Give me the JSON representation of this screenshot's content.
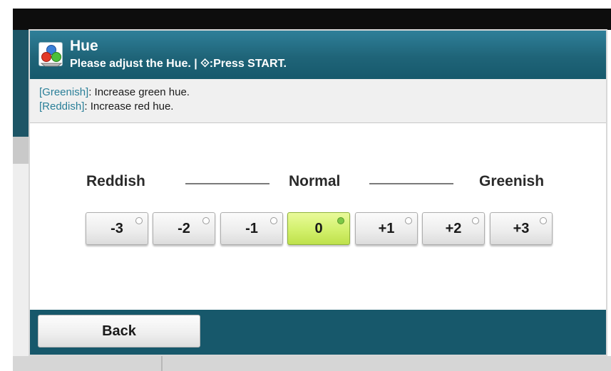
{
  "dialog": {
    "title": "Hue",
    "subtitle": "Please adjust the Hue. | ⟐:Press START.",
    "icon": "color-circles-icon"
  },
  "info": {
    "line1_key": "[Greenish]",
    "line1_text": ": Increase green hue.",
    "line2_key": "[Reddish]",
    "line2_text": ": Increase red hue."
  },
  "scale": {
    "left_label": "Reddish",
    "center_label": "Normal",
    "right_label": "Greenish"
  },
  "values": {
    "options": [
      "-3",
      "-2",
      "-1",
      "0",
      "+1",
      "+2",
      "+3"
    ],
    "selected": "0"
  },
  "footer": {
    "back_label": "Back"
  },
  "colors": {
    "header": "#1f6478",
    "footer": "#17586b",
    "selected_button": "#d2f06c",
    "info_key": "#2a7f98"
  }
}
